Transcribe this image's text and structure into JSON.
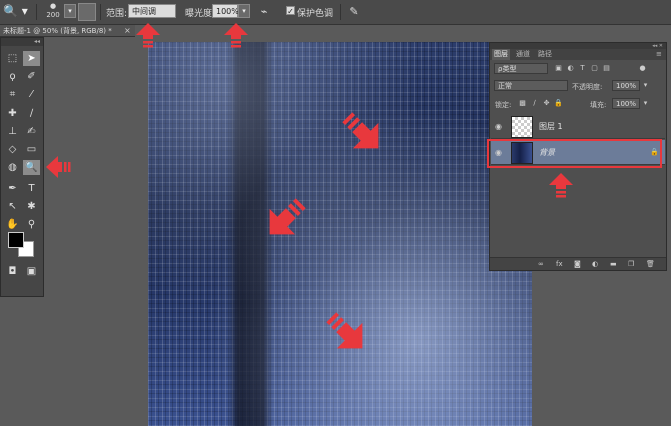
{
  "options_bar": {
    "brush_size": "200",
    "range_label": "范围:",
    "range_value": "中间调",
    "exposure_label": "曝光度:",
    "exposure_value": "100%",
    "protect_tones_label": "保护色调",
    "protect_tones_checked": true
  },
  "document_tab": {
    "title": "未标题-1 @ 50% (背景, RGB/8) *",
    "close": "×"
  },
  "layers_panel": {
    "tabs": [
      "图层",
      "通道",
      "路径"
    ],
    "active_tab": 0,
    "filter_kind": "ρ类型",
    "blend_mode": "正常",
    "opacity_label": "不透明度:",
    "opacity_value": "100%",
    "lock_label": "锁定:",
    "fill_label": "填充:",
    "fill_value": "100%",
    "layers": [
      {
        "name": "图层 1",
        "thumbnail": "transparent",
        "selected": false,
        "locked": false
      },
      {
        "name": "背景",
        "thumbnail": "denim",
        "selected": true,
        "locked": true
      }
    ],
    "footer_icons": [
      "link-icon",
      "fx-icon",
      "mask-icon",
      "adjustment-icon",
      "group-icon",
      "new-layer-icon",
      "trash-icon"
    ]
  },
  "colors": {
    "annotation_red": "#e8383d",
    "foreground": "#000000",
    "background": "#ffffff"
  },
  "annotations": {
    "arrow_count": 7
  }
}
